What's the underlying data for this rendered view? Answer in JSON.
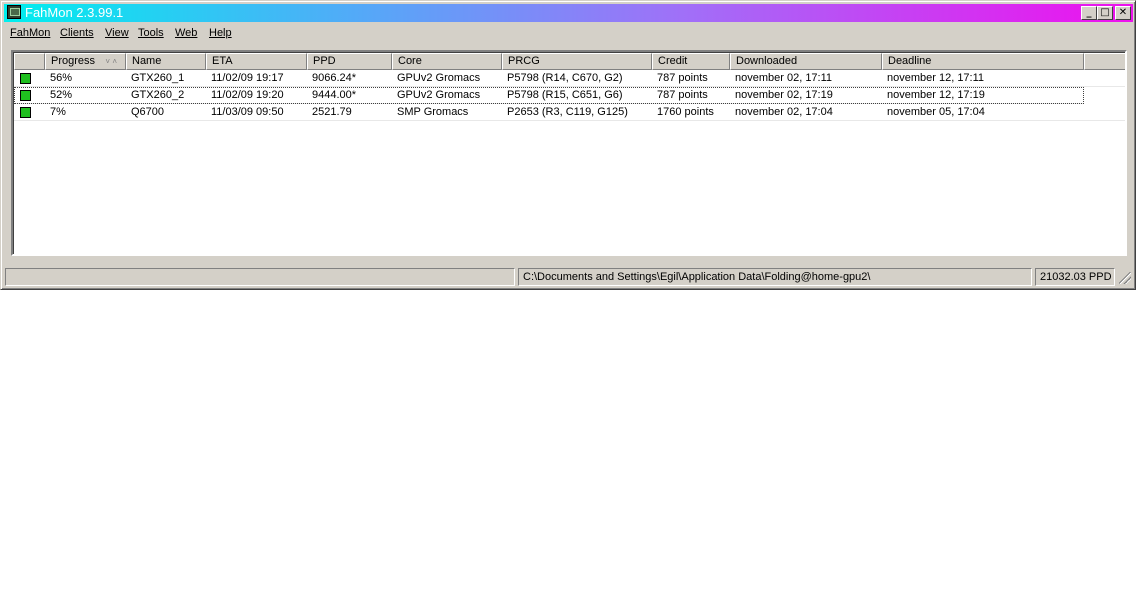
{
  "window": {
    "title": "FahMon 2.3.99.1",
    "icon": "fahmon-app-icon",
    "caption_buttons": {
      "minimize": "_",
      "maximize": "□",
      "close": "✕"
    }
  },
  "menu": [
    {
      "label": "FahMon"
    },
    {
      "label": "Clients"
    },
    {
      "label": "View"
    },
    {
      "label": "Tools"
    },
    {
      "label": "Web"
    },
    {
      "label": "Help"
    }
  ],
  "table": {
    "columns": [
      "",
      "Progress",
      "Name",
      "ETA",
      "PPD",
      "Core",
      "PRCG",
      "Credit",
      "Downloaded",
      "Deadline"
    ],
    "sort_indicator": "˅ ˄",
    "status_color": "#1fbf1f",
    "rows": [
      {
        "progress": "56%",
        "name": "GTX260_1",
        "eta": "11/02/09  19:17",
        "ppd": "9066.24*",
        "core": "GPUv2 Gromacs",
        "prcg": "P5798 (R14, C670, G2)",
        "credit": "787 points",
        "downloaded": "november 02, 17:11",
        "deadline": "november 12, 17:11"
      },
      {
        "progress": "52%",
        "name": "GTX260_2",
        "eta": "11/02/09  19:20",
        "ppd": "9444.00*",
        "core": "GPUv2 Gromacs",
        "prcg": "P5798 (R15, C651, G6)",
        "credit": "787 points",
        "downloaded": "november 02, 17:19",
        "deadline": "november 12, 17:19"
      },
      {
        "progress": "7%",
        "name": "Q6700",
        "eta": "11/03/09  09:50",
        "ppd": "2521.79",
        "core": "SMP Gromacs",
        "prcg": "P2653 (R3, C119, G125)",
        "credit": "1760 points",
        "downloaded": "november 02, 17:04",
        "deadline": "november 05, 17:04"
      }
    ]
  },
  "statusbar": {
    "left": "",
    "path": "C:\\Documents and Settings\\Egil\\Application Data\\Folding@home-gpu2\\",
    "total_ppd": "21032.03 PPD"
  }
}
